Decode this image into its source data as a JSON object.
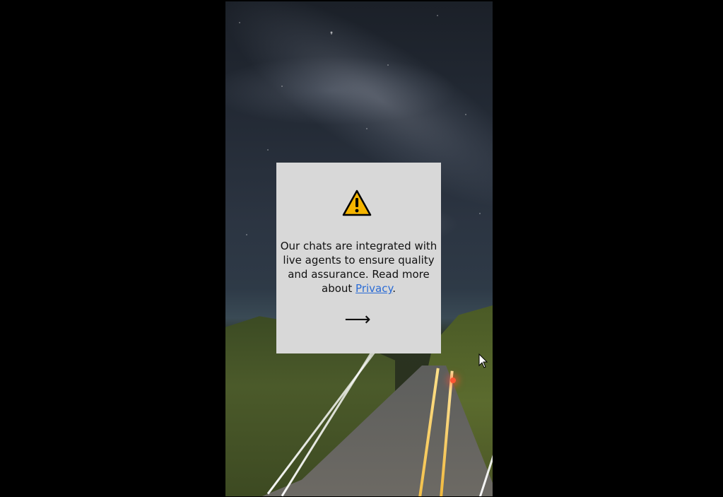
{
  "dialog": {
    "message_before_link": "Our chats are integrated with live agents to ensure quality and assurance. Read more about ",
    "link_label": "Privacy",
    "message_after_link": ".",
    "next_glyph": "⟶"
  },
  "icons": {
    "warning": "warning-icon",
    "next": "arrow-right-icon",
    "cursor": "mouse-pointer-icon"
  },
  "colors": {
    "dialog_background": "#d8d8d8",
    "link": "#2a6bd6",
    "warning_fill": "#f4b400",
    "page_background": "#000000"
  }
}
